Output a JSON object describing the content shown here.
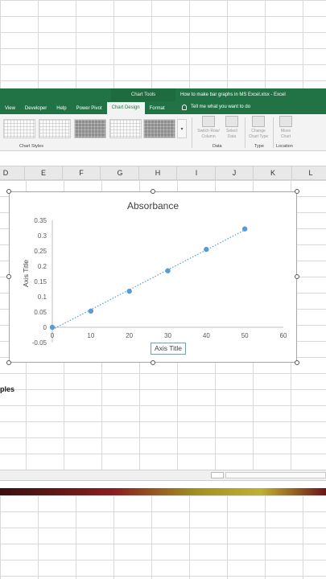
{
  "window": {
    "title": "How to make bar graphs in MS Excel.xlsx  -  Excel",
    "context_tab": "Chart Tools"
  },
  "ribbon": {
    "tabs": [
      {
        "label": "View",
        "active": false
      },
      {
        "label": "Developer",
        "active": false
      },
      {
        "label": "Help",
        "active": false
      },
      {
        "label": "Power Pivot",
        "active": false
      },
      {
        "label": "Chart Design",
        "active": true
      },
      {
        "label": "Format",
        "active": false
      }
    ],
    "tell_me": "Tell me what you want to do",
    "groups": {
      "chart_styles": "Chart Styles",
      "data": "Data",
      "type": "Type",
      "location": "Location"
    },
    "buttons": {
      "switch_row_column_1": "Switch Row/",
      "switch_row_column_2": "Column",
      "select_data_1": "Select",
      "select_data_2": "Data",
      "change_chart_type_1": "Change",
      "change_chart_type_2": "Chart Type",
      "move_chart_1": "Move",
      "move_chart_2": "Chart"
    },
    "gallery_scroll": "▾"
  },
  "sheet": {
    "columns": [
      "D",
      "E",
      "F",
      "G",
      "H",
      "I",
      "J",
      "K",
      "L"
    ],
    "cell_text": "ples"
  },
  "colors": {
    "excel_green": "#217346",
    "marker": "#5b9bd5"
  },
  "chart_data": {
    "type": "scatter",
    "title": "Absorbance",
    "xlabel": "Axis Title",
    "ylabel": "Axis Title",
    "xlim": [
      0,
      60
    ],
    "ylim": [
      -0.05,
      0.35
    ],
    "x_ticks": [
      0,
      10,
      20,
      30,
      40,
      50,
      60
    ],
    "y_ticks": [
      -0.05,
      0,
      0.05,
      0.1,
      0.15,
      0.2,
      0.25,
      0.3,
      0.35
    ],
    "y_tick_labels": [
      "-0.05",
      "0",
      "0.05",
      "0.1",
      "0.15",
      "0.2",
      "0.25",
      "0.3",
      "0.35"
    ],
    "series": [
      {
        "x": [
          0,
          10,
          20,
          30,
          40,
          50
        ],
        "y": [
          0,
          0.053,
          0.118,
          0.185,
          0.255,
          0.322
        ]
      }
    ],
    "trendline": "linear-dotted",
    "gridlines": false
  }
}
